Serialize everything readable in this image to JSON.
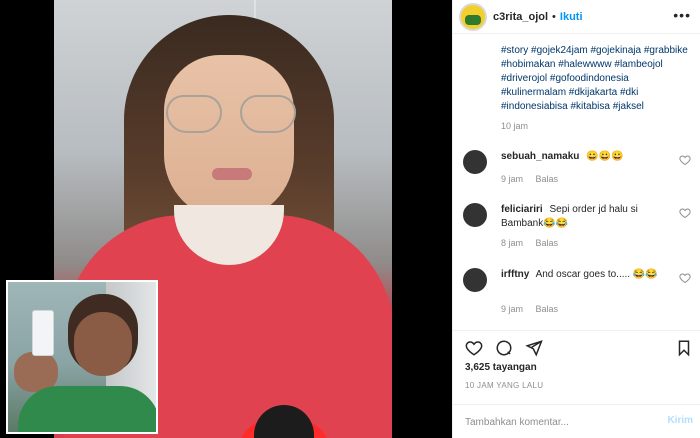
{
  "header": {
    "username": "c3rita_ojol",
    "separator": "•",
    "follow_label": "Ikuti",
    "more_icon": "more-horizontal-icon"
  },
  "caption": {
    "hashtags": "#story #gojek24jam #gojekinaja #grabbike #hobimakan #halewwww #lambeojol #driverojol #gofoodindonesia #kulinermalam #dkijakarta #dki #indonesiabisa #kitabisa #jaksel",
    "time": "10 jam"
  },
  "comments": [
    {
      "username": "sebuah_namaku",
      "text": "😀😀😀",
      "time": "9 jam",
      "reply_label": "Balas"
    },
    {
      "username": "feliciariri",
      "text": "Sepi order jd halu si Bambank😂😂",
      "time": "8 jam",
      "reply_label": "Balas"
    },
    {
      "username": "irfftny",
      "text": "And oscar goes to..... 😂😂",
      "time": "9 jam",
      "reply_label": "Balas"
    }
  ],
  "actions": {
    "icons": [
      "heart-icon",
      "comment-icon",
      "share-icon",
      "bookmark-icon"
    ]
  },
  "stats": {
    "views": "3,625 tayangan",
    "posted": "10 JAM YANG LALU"
  },
  "composer": {
    "placeholder": "Tambahkan komentar...",
    "send_label": "Kirim"
  },
  "colors": {
    "link": "#0095f6",
    "hashtag": "#00376b",
    "muted": "#8e8e8e",
    "send_disabled": "#b2dffc"
  }
}
